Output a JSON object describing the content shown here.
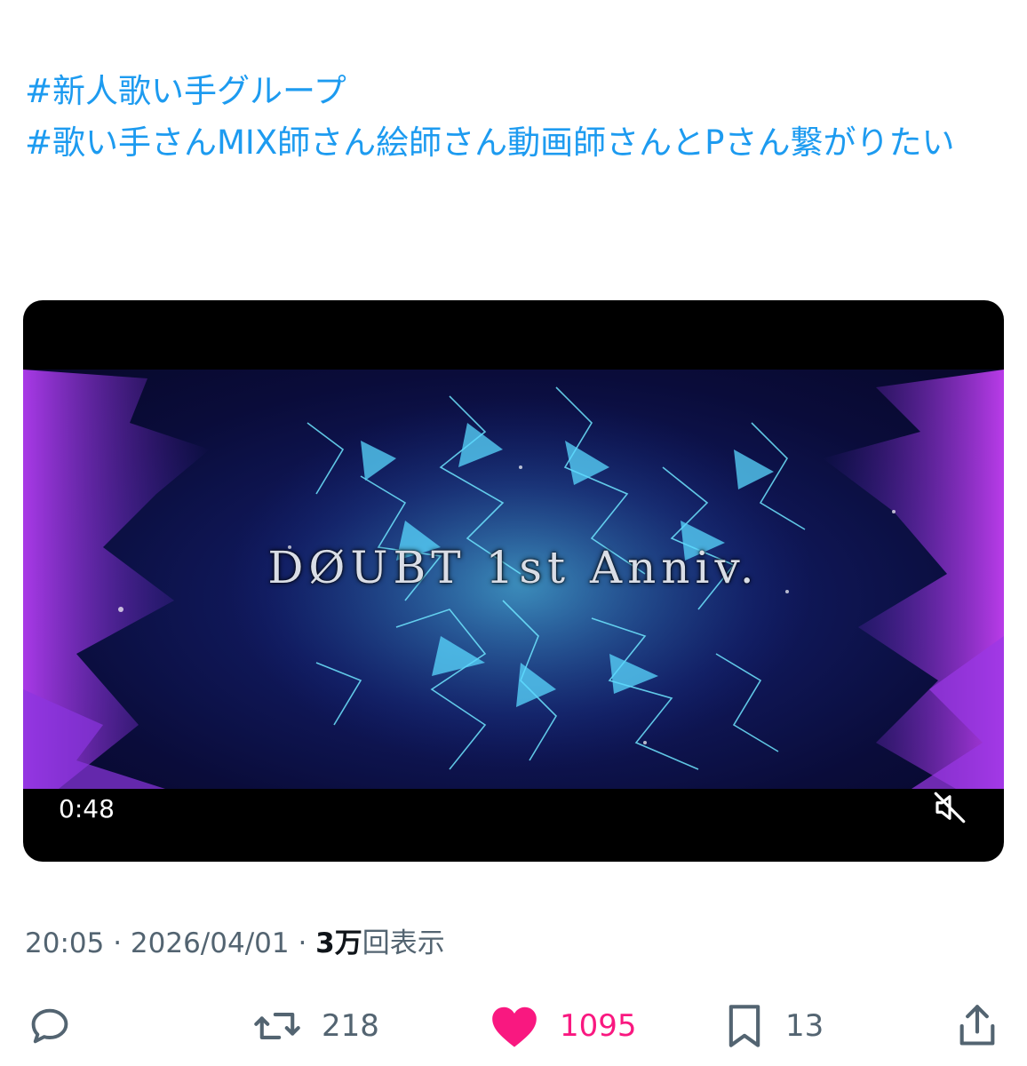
{
  "post": {
    "hashtags": [
      "#新人歌い手グループ",
      "#歌い手さんMIX師さん絵師さん動画師さんとPさん繋がりたい"
    ],
    "video": {
      "title_text": "DØUBT 1st Anniv.",
      "duration": "0:48",
      "muted": true
    },
    "meta": {
      "time": "20:05",
      "separator": " · ",
      "date": "2026/04/01",
      "views_count": "3万",
      "views_label": "回表示"
    },
    "actions": {
      "reply": {
        "icon": "reply-icon"
      },
      "repost": {
        "icon": "repost-icon",
        "count": "218"
      },
      "like": {
        "icon": "heart-icon",
        "count": "1095",
        "active": true,
        "color": "#f91880"
      },
      "bookmark": {
        "icon": "bookmark-icon",
        "count": "13"
      },
      "share": {
        "icon": "share-icon"
      }
    },
    "link_color": "#1d9bf0",
    "meta_color": "#536471"
  }
}
